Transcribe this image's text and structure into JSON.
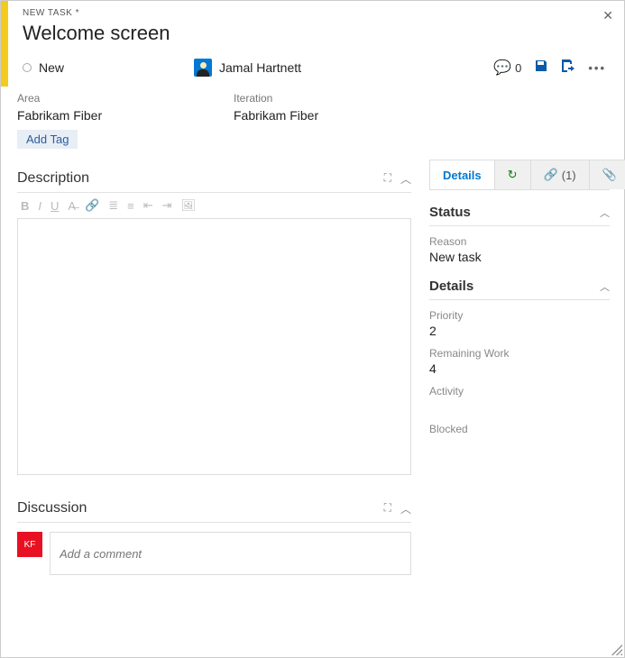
{
  "header": {
    "type_label": "NEW TASK *",
    "title": "Welcome screen",
    "state": "New",
    "assignee": "Jamal Hartnett",
    "comment_count": "0"
  },
  "fields": {
    "area_label": "Area",
    "area_value": "Fabrikam Fiber",
    "iteration_label": "Iteration",
    "iteration_value": "Fabrikam Fiber"
  },
  "tags": {
    "add_label": "Add Tag"
  },
  "tabs": {
    "details": "Details",
    "links": "(1)"
  },
  "description": {
    "heading": "Description"
  },
  "discussion": {
    "heading": "Discussion",
    "avatar_initials": "KF",
    "placeholder": "Add a comment"
  },
  "right_panel": {
    "status_title": "Status",
    "reason_label": "Reason",
    "reason_value": "New task",
    "details_title": "Details",
    "priority_label": "Priority",
    "priority_value": "2",
    "remaining_label": "Remaining Work",
    "remaining_value": "4",
    "activity_label": "Activity",
    "blocked_label": "Blocked"
  }
}
